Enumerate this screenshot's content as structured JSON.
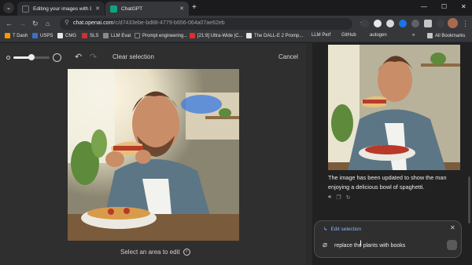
{
  "browser": {
    "tabs": [
      {
        "title": "Editing your images with DALL·E",
        "favicon_color": "#2b2f36",
        "active": false
      },
      {
        "title": "ChatGPT",
        "favicon_color": "#0fa47f",
        "active": true
      }
    ],
    "new_tab_icon": "plus-icon",
    "url": "chat.openai.com",
    "url_path": "/c/d7433ebe-bd88-4779-b656-064a07ae62eb"
  },
  "bookmarks": [
    {
      "label": "T Dash",
      "color": "#f29900"
    },
    {
      "label": "USPS",
      "color": "#3b6fc9"
    },
    {
      "label": "CMG",
      "color": "#e8e8e8"
    },
    {
      "label": "SLS",
      "color": "#c9322f"
    },
    {
      "label": "LLM Eval",
      "color": "#8a8a8a"
    },
    {
      "label": "Prompt engineering...",
      "color": "#333333"
    },
    {
      "label": "[21:9] Ultra-Wide |C...",
      "color": "#e02d2d"
    },
    {
      "label": "The DALL-E 2 Promp...",
      "color": "#e8e8e8"
    },
    {
      "label": "LLM Perf",
      "color": "#4a4a4a"
    },
    {
      "label": "GitHub",
      "color": "#3a3a3a"
    },
    {
      "label": "autogen",
      "color": "#3a3a3a"
    }
  ],
  "all_bookmarks": "All Bookmarks",
  "editor": {
    "brush_size_fraction": 0.5,
    "clear_selection": "Clear selection",
    "cancel": "Cancel",
    "hint": "Select an area to edit",
    "info_glyph": "i"
  },
  "chat": {
    "message": "The image has been updated to show the man enjoying a delicious bowl of spaghetti.",
    "composer": {
      "edit_selection": "Edit selection",
      "prompt": "replace the plants with books"
    }
  },
  "colors": {
    "accent": "#8ab4f8",
    "editor_bg": "#2f2f2f",
    "chat_bg": "#212121"
  }
}
